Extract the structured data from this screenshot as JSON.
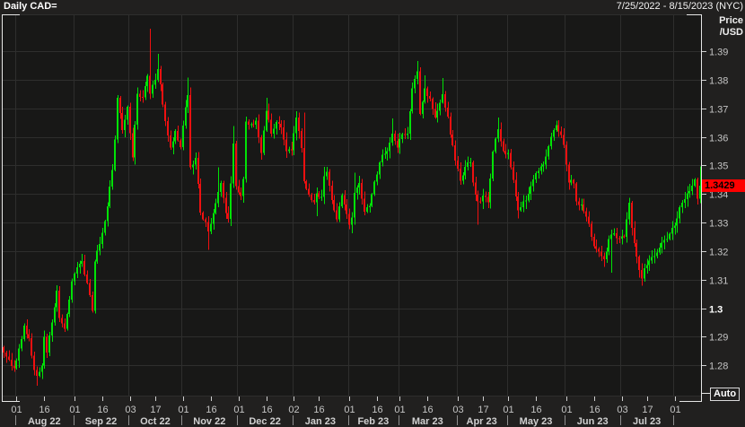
{
  "header": {
    "title": "Daily CAD=",
    "date_range": "7/25/2022 - 8/15/2023 (NYC)"
  },
  "y_axis": {
    "title_line1": "Price",
    "title_line2": "/USD",
    "tick_labels": [
      "1.39",
      "1.38",
      "1.37",
      "1.36",
      "1.35",
      "1.34",
      "1.33",
      "1.32",
      "1.31",
      "1.3",
      "1.29",
      "1.28"
    ],
    "bold_label": "1.3",
    "last_price": "1.3429"
  },
  "x_axis": {
    "day_ticks": [
      [
        5,
        "01"
      ],
      [
        16,
        "16"
      ],
      [
        28,
        "01"
      ],
      [
        39,
        "16"
      ],
      [
        50,
        "03"
      ],
      [
        60,
        "17"
      ],
      [
        71,
        "01"
      ],
      [
        82,
        "16"
      ],
      [
        93,
        "01"
      ],
      [
        104,
        "16"
      ],
      [
        115,
        "02"
      ],
      [
        125,
        "16"
      ],
      [
        137,
        "01"
      ],
      [
        148,
        "16"
      ],
      [
        157,
        "01"
      ],
      [
        168,
        "16"
      ],
      [
        180,
        "03"
      ],
      [
        190,
        "17"
      ],
      [
        200,
        "01"
      ],
      [
        211,
        "16"
      ],
      [
        223,
        "01"
      ],
      [
        234,
        "16"
      ],
      [
        245,
        "03"
      ],
      [
        255,
        "17"
      ],
      [
        266,
        "01"
      ]
    ],
    "month_labels": [
      "Aug 22",
      "Sep 22",
      "Oct 22",
      "Nov 22",
      "Dec 22",
      "Jan 23",
      "Feb 23",
      "Mar 23",
      "Apr 23",
      "May 23",
      "Jun 23",
      "Jul 23"
    ],
    "month_boundaries": [
      5,
      28,
      50,
      71,
      93,
      115,
      137,
      157,
      180,
      200,
      223,
      245,
      266
    ]
  },
  "auto_button": {
    "label": "Auto"
  },
  "colors": {
    "background": "#21201f",
    "plot_background": "#181817",
    "grid": "#2e2e2d",
    "frame": "#e6e6e6",
    "tick": "#cfcfcf",
    "axis_text": "#c4c4c4",
    "axis_text_bold": "#ffffff",
    "month_text": "#d0d0d0",
    "up": "#00e206",
    "down": "#ef1010",
    "last_price_bg": "#ff0000",
    "last_price_text": "#000000"
  },
  "chart_data": {
    "type": "candlestick",
    "title": "Daily CAD=",
    "instrument": "CAD= (USD/CAD exchange rate)",
    "timeframe": "daily",
    "date_range": [
      "7/25/2022",
      "8/15/2023"
    ],
    "num_days": 277,
    "ylabel": "Price /USD",
    "y_gridlines": [
      1.39,
      1.38,
      1.37,
      1.36,
      1.35,
      1.34,
      1.33,
      1.32,
      1.31,
      1.3,
      1.29,
      1.28
    ],
    "visible_price_range": [
      1.2694,
      1.4035
    ],
    "last_price": 1.3429,
    "close_anchors": [
      [
        0,
        1.2845
      ],
      [
        2,
        1.2818
      ],
      [
        4,
        1.279
      ],
      [
        6,
        1.286
      ],
      [
        8,
        1.294
      ],
      [
        10,
        1.2895
      ],
      [
        12,
        1.2782
      ],
      [
        13,
        1.2762
      ],
      [
        15,
        1.2798
      ],
      [
        16,
        1.29
      ],
      [
        17,
        1.2845
      ],
      [
        19,
        1.295
      ],
      [
        21,
        1.3062
      ],
      [
        22,
        1.2965
      ],
      [
        24,
        1.2928
      ],
      [
        26,
        1.3032
      ],
      [
        27,
        1.3095
      ],
      [
        29,
        1.3142
      ],
      [
        31,
        1.3165
      ],
      [
        33,
        1.309
      ],
      [
        35,
        1.299
      ],
      [
        36,
        1.3165
      ],
      [
        38,
        1.3225
      ],
      [
        39,
        1.3262
      ],
      [
        41,
        1.3358
      ],
      [
        43,
        1.3485
      ],
      [
        44,
        1.359
      ],
      [
        45,
        1.3735
      ],
      [
        47,
        1.3622
      ],
      [
        49,
        1.3705
      ],
      [
        50,
        1.3615
      ],
      [
        51,
        1.3528
      ],
      [
        53,
        1.3748
      ],
      [
        55,
        1.3738
      ],
      [
        57,
        1.3812
      ],
      [
        58,
        1.3752
      ],
      [
        60,
        1.38
      ],
      [
        61,
        1.3838
      ],
      [
        62,
        1.3782
      ],
      [
        64,
        1.3655
      ],
      [
        66,
        1.3562
      ],
      [
        68,
        1.3622
      ],
      [
        70,
        1.3562
      ],
      [
        72,
        1.3702
      ],
      [
        73,
        1.3745
      ],
      [
        74,
        1.3492
      ],
      [
        76,
        1.3525
      ],
      [
        78,
        1.3332
      ],
      [
        80,
        1.3302
      ],
      [
        81,
        1.3268
      ],
      [
        83,
        1.3332
      ],
      [
        85,
        1.3408
      ],
      [
        86,
        1.3438
      ],
      [
        88,
        1.3332
      ],
      [
        89,
        1.3312
      ],
      [
        91,
        1.3575
      ],
      [
        92,
        1.3428
      ],
      [
        94,
        1.3392
      ],
      [
        95,
        1.3455
      ],
      [
        96,
        1.3652
      ],
      [
        98,
        1.3642
      ],
      [
        100,
        1.3655
      ],
      [
        102,
        1.3545
      ],
      [
        104,
        1.3692
      ],
      [
        106,
        1.3612
      ],
      [
        108,
        1.3652
      ],
      [
        110,
        1.3632
      ],
      [
        112,
        1.3548
      ],
      [
        114,
        1.3555
      ],
      [
        116,
        1.3668
      ],
      [
        118,
        1.3562
      ],
      [
        119,
        1.3445
      ],
      [
        121,
        1.3398
      ],
      [
        123,
        1.3372
      ],
      [
        124,
        1.3402
      ],
      [
        126,
        1.3388
      ],
      [
        127,
        1.3462
      ],
      [
        128,
        1.3478
      ],
      [
        130,
        1.3378
      ],
      [
        132,
        1.3312
      ],
      [
        134,
        1.3398
      ],
      [
        136,
        1.3332
      ],
      [
        137,
        1.3292
      ],
      [
        138,
        1.3318
      ],
      [
        139,
        1.3402
      ],
      [
        141,
        1.3438
      ],
      [
        143,
        1.3338
      ],
      [
        145,
        1.3358
      ],
      [
        147,
        1.3442
      ],
      [
        148,
        1.3468
      ],
      [
        150,
        1.3538
      ],
      [
        152,
        1.3548
      ],
      [
        154,
        1.3612
      ],
      [
        156,
        1.3562
      ],
      [
        158,
        1.3608
      ],
      [
        160,
        1.3612
      ],
      [
        162,
        1.3768
      ],
      [
        164,
        1.3828
      ],
      [
        165,
        1.3682
      ],
      [
        167,
        1.3768
      ],
      [
        169,
        1.3732
      ],
      [
        171,
        1.3668
      ],
      [
        173,
        1.3722
      ],
      [
        174,
        1.3748
      ],
      [
        176,
        1.3672
      ],
      [
        177,
        1.3608
      ],
      [
        179,
        1.3518
      ],
      [
        181,
        1.3448
      ],
      [
        183,
        1.3492
      ],
      [
        185,
        1.3512
      ],
      [
        186,
        1.3438
      ],
      [
        188,
        1.3372
      ],
      [
        190,
        1.3392
      ],
      [
        192,
        1.3372
      ],
      [
        194,
        1.3548
      ],
      [
        196,
        1.3628
      ],
      [
        198,
        1.3548
      ],
      [
        200,
        1.3542
      ],
      [
        202,
        1.3448
      ],
      [
        204,
        1.3342
      ],
      [
        206,
        1.3372
      ],
      [
        208,
        1.3398
      ],
      [
        210,
        1.3452
      ],
      [
        212,
        1.3482
      ],
      [
        214,
        1.3502
      ],
      [
        216,
        1.3568
      ],
      [
        218,
        1.3622
      ],
      [
        219,
        1.3642
      ],
      [
        221,
        1.3608
      ],
      [
        222,
        1.3572
      ],
      [
        224,
        1.3442
      ],
      [
        226,
        1.3438
      ],
      [
        227,
        1.3372
      ],
      [
        229,
        1.3362
      ],
      [
        231,
        1.3322
      ],
      [
        233,
        1.3252
      ],
      [
        234,
        1.3218
      ],
      [
        236,
        1.3198
      ],
      [
        238,
        1.3172
      ],
      [
        240,
        1.3242
      ],
      [
        242,
        1.3262
      ],
      [
        244,
        1.3242
      ],
      [
        246,
        1.3252
      ],
      [
        248,
        1.3368
      ],
      [
        249,
        1.3282
      ],
      [
        251,
        1.3182
      ],
      [
        253,
        1.3102
      ],
      [
        254,
        1.3138
      ],
      [
        256,
        1.3168
      ],
      [
        258,
        1.3182
      ],
      [
        260,
        1.3212
      ],
      [
        262,
        1.3238
      ],
      [
        264,
        1.3258
      ],
      [
        266,
        1.3288
      ],
      [
        268,
        1.3352
      ],
      [
        270,
        1.3382
      ],
      [
        272,
        1.3412
      ],
      [
        274,
        1.3452
      ],
      [
        275,
        1.3382
      ],
      [
        276,
        1.3429
      ]
    ],
    "wick_highs": [
      [
        58,
        1.3978
      ],
      [
        61,
        1.389
      ],
      [
        73,
        1.3808
      ],
      [
        85,
        1.3494
      ],
      [
        91,
        1.3638
      ],
      [
        104,
        1.3737
      ],
      [
        119,
        1.3685
      ],
      [
        127,
        1.3495
      ],
      [
        139,
        1.3475
      ],
      [
        154,
        1.3665
      ],
      [
        164,
        1.3865
      ],
      [
        167,
        1.3815
      ],
      [
        174,
        1.3805
      ],
      [
        196,
        1.3668
      ],
      [
        219,
        1.3654
      ],
      [
        248,
        1.3387
      ],
      [
        276,
        1.3497
      ]
    ],
    "wick_lows": [
      [
        13,
        1.2728
      ],
      [
        81,
        1.3205
      ],
      [
        124,
        1.3322
      ],
      [
        138,
        1.3262
      ],
      [
        188,
        1.3292
      ],
      [
        204,
        1.3315
      ],
      [
        238,
        1.3144
      ],
      [
        241,
        1.3125
      ],
      [
        253,
        1.3078
      ]
    ],
    "noise_seed": 77
  }
}
